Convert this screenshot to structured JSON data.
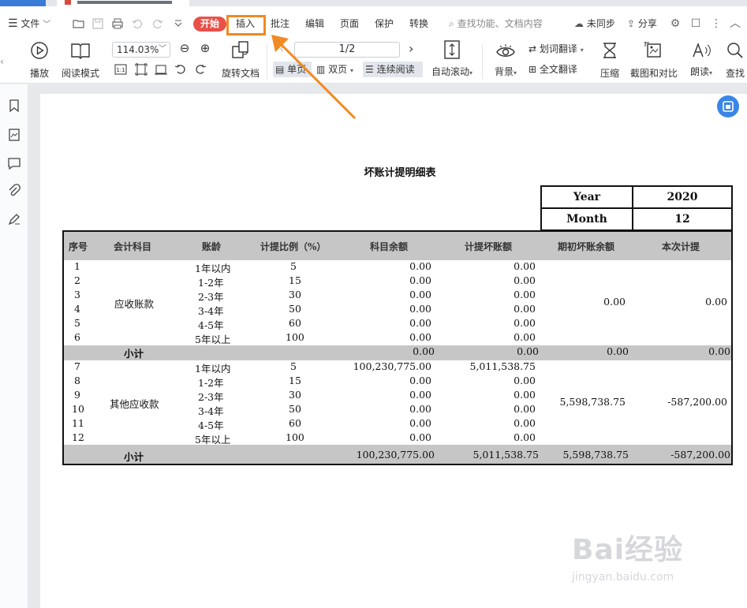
{
  "menu": {
    "file": "文件",
    "tabs": [
      "开始",
      "插入",
      "批注",
      "编辑",
      "页面",
      "保护",
      "转换"
    ],
    "search_placeholder": "查找功能、文档内容",
    "sync": "未同步",
    "share": "分享"
  },
  "toolbar": {
    "play": "播放",
    "read_mode": "阅读模式",
    "zoom": "114.03%",
    "rotate": "旋转文档",
    "page_indicator": "1/2",
    "single": "单页",
    "double": "双页",
    "continuous": "连续阅读",
    "auto_scroll": "自动滚动",
    "background": "背景",
    "word_translate": "划词翻译",
    "full_translate": "全文翻译",
    "compress": "压缩",
    "screenshot_compare": "截图和对比",
    "read_aloud": "朗读",
    "find": "查找"
  },
  "document": {
    "title": "坏账计提明细表",
    "year_label": "Year",
    "year_value": "2020",
    "month_label": "Month",
    "month_value": "12",
    "headers": [
      "序号",
      "会计科目",
      "账龄",
      "计提比例（%）",
      "科目余额",
      "计提坏账额",
      "期初坏账余额",
      "本次计提"
    ],
    "section1": {
      "account": "应收账款",
      "rows": [
        {
          "no": "1",
          "age": "1年以内",
          "rate": "5",
          "balance": "0.00",
          "provision": "0.00"
        },
        {
          "no": "2",
          "age": "1-2年",
          "rate": "15",
          "balance": "0.00",
          "provision": "0.00"
        },
        {
          "no": "3",
          "age": "2-3年",
          "rate": "30",
          "balance": "0.00",
          "provision": "0.00"
        },
        {
          "no": "4",
          "age": "3-4年",
          "rate": "50",
          "balance": "0.00",
          "provision": "0.00"
        },
        {
          "no": "5",
          "age": "4-5年",
          "rate": "60",
          "balance": "0.00",
          "provision": "0.00"
        },
        {
          "no": "6",
          "age": "5年以上",
          "rate": "100",
          "balance": "0.00",
          "provision": "0.00"
        }
      ],
      "opening": "0.00",
      "current": "0.00",
      "subtotal": {
        "label": "小计",
        "balance": "0.00",
        "provision": "0.00",
        "opening": "0.00",
        "current": "0.00"
      }
    },
    "section2": {
      "account": "其他应收款",
      "rows": [
        {
          "no": "7",
          "age": "1年以内",
          "rate": "5",
          "balance": "100,230,775.00",
          "provision": "5,011,538.75"
        },
        {
          "no": "8",
          "age": "1-2年",
          "rate": "15",
          "balance": "0.00",
          "provision": "0.00"
        },
        {
          "no": "9",
          "age": "2-3年",
          "rate": "30",
          "balance": "0.00",
          "provision": "0.00"
        },
        {
          "no": "10",
          "age": "3-4年",
          "rate": "50",
          "balance": "0.00",
          "provision": "0.00"
        },
        {
          "no": "11",
          "age": "4-5年",
          "rate": "60",
          "balance": "0.00",
          "provision": "0.00"
        },
        {
          "no": "12",
          "age": "5年以上",
          "rate": "100",
          "balance": "0.00",
          "provision": "0.00"
        }
      ],
      "opening": "5,598,738.75",
      "current": "-587,200.00",
      "subtotal": {
        "label": "小计",
        "balance": "100,230,775.00",
        "provision": "5,011,538.75",
        "opening": "5,598,738.75",
        "current": "-587,200.00"
      }
    }
  },
  "watermark": {
    "brand": "Bai经验",
    "url": "jingyan.baidu.com"
  },
  "colors": {
    "home_tab": "#e8514a",
    "highlight": "#f08a24",
    "accent": "#3a86e6",
    "header_band": "#c6c6c6"
  }
}
